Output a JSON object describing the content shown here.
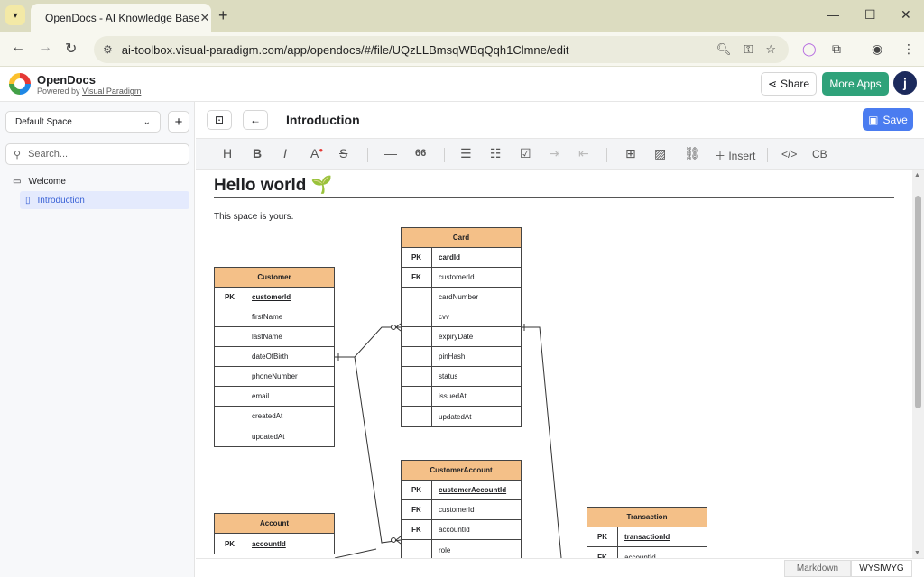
{
  "browser": {
    "tab_title": "OpenDocs - AI Knowledge Base",
    "url": "ai-toolbox.visual-paradigm.com/app/opendocs/#/file/UQzLLBmsqWBqQqh1Clmne/edit"
  },
  "app": {
    "name": "OpenDocs",
    "powered_prefix": "Powered by ",
    "powered_link": "Visual Paradigm",
    "share_label": "Share",
    "more_apps_label": "More Apps",
    "avatar_initial": "j"
  },
  "sidebar": {
    "space": "Default Space",
    "search_placeholder": "Search...",
    "tree": [
      {
        "label": "Welcome"
      },
      {
        "label": "Introduction"
      }
    ]
  },
  "editor": {
    "title": "Introduction",
    "save_label": "Save",
    "toolbar": {
      "heading": "H",
      "bold": "B",
      "italic": "I",
      "color": "A",
      "strike": "S",
      "hr": "—",
      "quote": "66",
      "insert": "Insert",
      "code": "</>",
      "codeblock": "CB"
    },
    "heading": "Hello world 🌱",
    "paragraph": "This space is yours.",
    "modes": {
      "markdown": "Markdown",
      "wysiwyg": "WYSIWYG"
    }
  },
  "erd": {
    "entities": [
      {
        "name": "Card",
        "rows": [
          {
            "key": "PK",
            "field": "cardId"
          },
          {
            "key": "FK",
            "field": "customerId"
          },
          {
            "key": "",
            "field": "cardNumber"
          },
          {
            "key": "",
            "field": "cvv"
          },
          {
            "key": "",
            "field": "expiryDate"
          },
          {
            "key": "",
            "field": "pinHash"
          },
          {
            "key": "",
            "field": "status"
          },
          {
            "key": "",
            "field": "issuedAt"
          },
          {
            "key": "",
            "field": "updatedAt"
          }
        ]
      },
      {
        "name": "Customer",
        "rows": [
          {
            "key": "PK",
            "field": "customerId"
          },
          {
            "key": "",
            "field": "firstName"
          },
          {
            "key": "",
            "field": "lastName"
          },
          {
            "key": "",
            "field": "dateOfBirth"
          },
          {
            "key": "",
            "field": "phoneNumber"
          },
          {
            "key": "",
            "field": "email"
          },
          {
            "key": "",
            "field": "createdAt"
          },
          {
            "key": "",
            "field": "updatedAt"
          }
        ]
      },
      {
        "name": "CustomerAccount",
        "rows": [
          {
            "key": "PK",
            "field": "customerAccountId"
          },
          {
            "key": "FK",
            "field": "customerId"
          },
          {
            "key": "FK",
            "field": "accountId"
          },
          {
            "key": "",
            "field": "role"
          }
        ]
      },
      {
        "name": "Account",
        "rows": [
          {
            "key": "PK",
            "field": "accountId"
          }
        ]
      },
      {
        "name": "Transaction",
        "rows": [
          {
            "key": "PK",
            "field": "transactionId"
          },
          {
            "key": "FK",
            "field": "accountId"
          }
        ]
      }
    ]
  }
}
